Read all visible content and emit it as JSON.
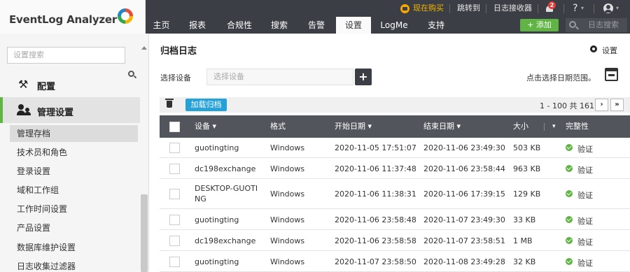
{
  "app": {
    "logo_text": "EventLog Analyzer"
  },
  "utility": {
    "buy_now": "现在购买",
    "jump_to": "跳转到",
    "log_receiver": "日志接收器",
    "notification_count": "2",
    "help": "?",
    "caret": "▾"
  },
  "nav": {
    "tabs": [
      {
        "label": "主页"
      },
      {
        "label": "报表"
      },
      {
        "label": "合规性"
      },
      {
        "label": "搜索"
      },
      {
        "label": "告警"
      },
      {
        "label": "设置"
      },
      {
        "label": "LogMe"
      },
      {
        "label": "支持"
      }
    ],
    "active_tab": "设置",
    "add_label": "+ 添加",
    "search_placeholder": "日志搜索"
  },
  "sidebar": {
    "search_placeholder": "设置搜索",
    "section_config": "配置",
    "section_manage": "管理设置",
    "items": [
      {
        "label": "管理存档",
        "active": true
      },
      {
        "label": "技术员和角色"
      },
      {
        "label": "登录设置"
      },
      {
        "label": "域和工作组"
      },
      {
        "label": "工作时间设置"
      },
      {
        "label": "产品设置"
      },
      {
        "label": "数据库维护设置"
      },
      {
        "label": "日志收集过滤器"
      }
    ]
  },
  "main": {
    "title": "归档日志",
    "settings_label": "设置",
    "device_label": "选择设备",
    "device_placeholder": "选择设备",
    "device_add": "+",
    "date_hint": "点击选择日期范围。",
    "load_archive": "加载归档",
    "pager_text": "1 - 100 共 161",
    "pager_next": "›",
    "pager_last": "»"
  },
  "table": {
    "columns": {
      "device": "设备 ▾",
      "format": "格式",
      "start": "开始日期 ▾",
      "end": "结束日期 ▾",
      "size": "大小",
      "filter": "▾",
      "integrity": "完整性"
    },
    "rows": [
      {
        "device": "guotingting",
        "format": "Windows",
        "start": "2020-11-05 17:51:07",
        "end": "2020-11-06 23:49:30",
        "size": "503 KB",
        "integrity": "验证"
      },
      {
        "device": "dc198exchange",
        "format": "Windows",
        "start": "2020-11-06 11:37:48",
        "end": "2020-11-06 23:58:44",
        "size": "963 KB",
        "integrity": "验证"
      },
      {
        "device": "DESKTOP-GUOTI",
        "device_line2": "NG",
        "format": "Windows",
        "start": "2020-11-06 11:38:31",
        "end": "2020-11-06 17:39:15",
        "size": "129 KB",
        "integrity": "验证"
      },
      {
        "device": "guotingting",
        "format": "Windows",
        "start": "2020-11-06 23:58:48",
        "end": "2020-11-07 23:49:30",
        "size": "33 KB",
        "integrity": "验证"
      },
      {
        "device": "dc198exchange",
        "format": "Windows",
        "start": "2020-11-06 23:58:58",
        "end": "2020-11-07 23:58:51",
        "size": "1 MB",
        "integrity": "验证"
      },
      {
        "device": "guotingting",
        "format": "Windows",
        "start": "2020-11-07 23:58:50",
        "end": "2020-11-08 23:49:28",
        "size": "32 KB",
        "integrity": "验证"
      }
    ]
  }
}
